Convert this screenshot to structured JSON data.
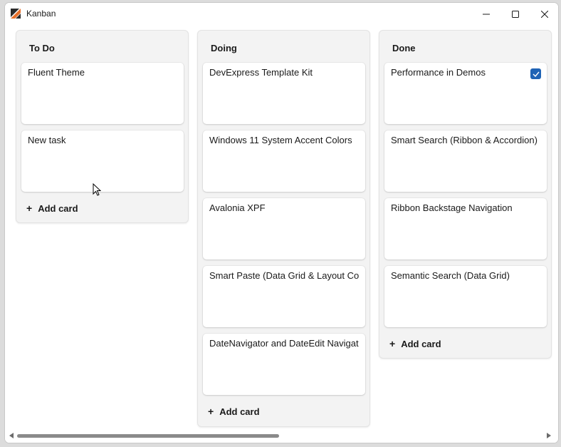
{
  "window": {
    "title": "Kanban"
  },
  "columns": [
    {
      "header": "To Do",
      "cards": [
        "Fluent Theme",
        "New task"
      ],
      "add_label": "Add card"
    },
    {
      "header": "Doing",
      "cards": [
        "DevExpress Template Kit",
        "Windows 11 System Accent Colors",
        "Avalonia XPF",
        "Smart Paste (Data Grid & Layout Cont",
        "DateNavigator and DateEdit Navigatic"
      ],
      "add_label": "Add card"
    },
    {
      "header": "Done",
      "cards": [
        "Performance in Demos",
        "Smart Search (Ribbon & Accordion)",
        "Ribbon Backstage Navigation",
        "Semantic Search (Data Grid)"
      ],
      "add_label": "Add card",
      "checked_card": 0
    }
  ],
  "colors": {
    "accent": "#1f63b5",
    "column_bg": "#f3f3f3",
    "card_bg": "#ffffff"
  },
  "icons": {
    "app": "app-logo-icon",
    "minimize": "minimize-icon",
    "maximize": "maximize-icon",
    "close": "close-icon",
    "add": "plus-icon",
    "check": "check-icon"
  }
}
